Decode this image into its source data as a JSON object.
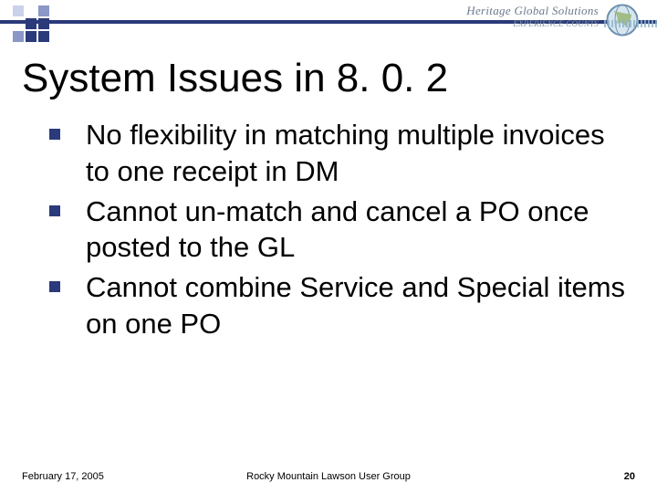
{
  "header": {
    "brand_name": "Heritage Global Solutions",
    "brand_tagline": "EXPERIENCE COUNTS"
  },
  "title": "System Issues in 8. 0. 2",
  "bullets": [
    "No flexibility in matching multiple invoices to one receipt in DM",
    "Cannot un-match and cancel a PO once posted to the GL",
    "Cannot combine Service and Special items on one PO"
  ],
  "footer": {
    "date": "February 17, 2005",
    "center": "Rocky Mountain Lawson User Group",
    "page_number": "20"
  }
}
